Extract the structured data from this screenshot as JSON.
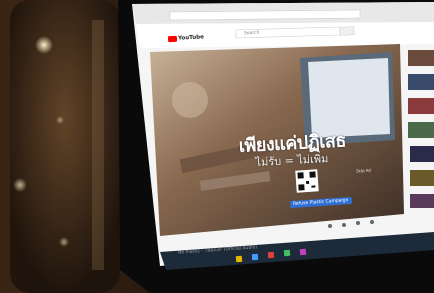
{
  "youtube": {
    "logo_text": "YouTube",
    "search_placeholder": "Search"
  },
  "video": {
    "headline": "เพียงแค่ปฏิเสธ",
    "subline": "ไม่รับ = ไม่เพิ่ม",
    "button_label": "Refuse Plastic Campaign",
    "overlay_label": "Skip Ad",
    "caption": "No Plastic - 'เพียงแค่' (Official Audio)"
  },
  "colors": {
    "youtube_red": "#ff0000",
    "button_blue": "#2f6fd6",
    "browser_chrome": "#e8e8e8"
  }
}
